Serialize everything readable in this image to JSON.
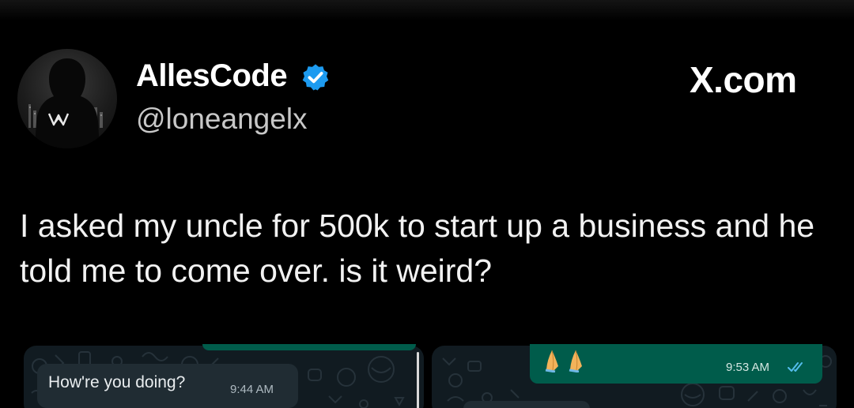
{
  "post": {
    "author_name": "AllesCode",
    "author_handle": "@loneangelx",
    "site_label": "X.com",
    "text": "I asked my uncle for 500k to start up a business and he told me to come over. is it weird?",
    "verified_color": "#1d9bf0"
  },
  "chat_left": {
    "message": "How're you doing?",
    "time": "9:44 AM"
  },
  "chat_right": {
    "emoji": "🙏🙏",
    "time": "9:53 AM",
    "status_icon": "double-check-read-icon"
  },
  "colors": {
    "background": "#000000",
    "outgoing_bubble": "#005c4b",
    "incoming_bubble": "#202c33",
    "read_ticks": "#53bdeb"
  }
}
